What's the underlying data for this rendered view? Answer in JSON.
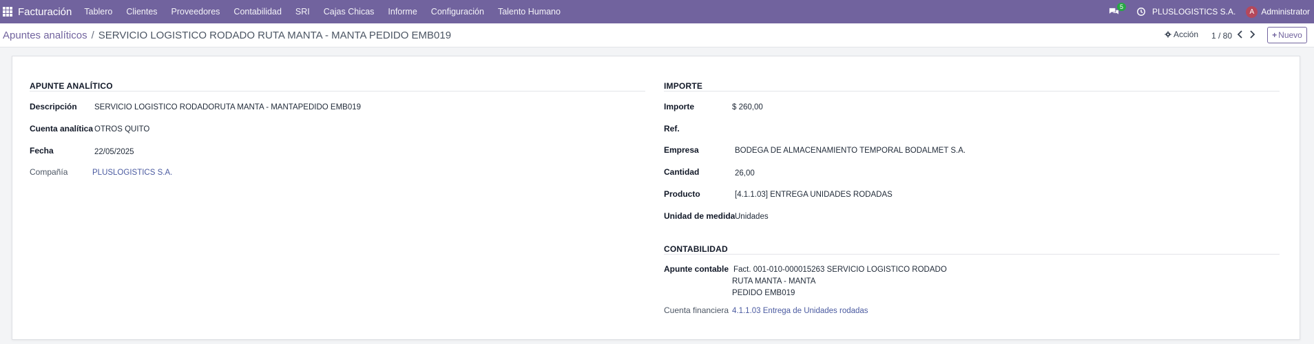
{
  "navbar": {
    "app_name": "Facturación",
    "menu": [
      "Tablero",
      "Clientes",
      "Proveedores",
      "Contabilidad",
      "SRI",
      "Cajas Chicas",
      "Informe",
      "Configuración",
      "Talento Humano"
    ],
    "chat_count": "5",
    "company": "PLUSLOGISTICS S.A.",
    "avatar_letter": "A",
    "user": "Administrator"
  },
  "controlbar": {
    "breadcrumb_parent": "Apuntes analíticos",
    "breadcrumb_separator": "/",
    "breadcrumb_current": "SERVICIO LOGISTICO RODADO RUTA MANTA - MANTA PEDIDO EMB019",
    "action_label": "Acción",
    "pager": "1 / 80",
    "new_label": "Nuevo"
  },
  "form": {
    "left": {
      "title": "APUNTE ANALÍTICO",
      "fields": [
        {
          "label": "Descripción",
          "value": "SERVICIO LOGISTICO RODADORUTA MANTA - MANTAPEDIDO EMB019"
        },
        {
          "label": "Cuenta analítica",
          "value": "OTROS QUITO"
        },
        {
          "label": "Fecha",
          "value": "22/05/2025"
        },
        {
          "label": "Compañía",
          "value": "PLUSLOGISTICS S.A."
        }
      ]
    },
    "right": {
      "title": "IMPORTE",
      "fields": [
        {
          "label": "Importe",
          "value": "$ 260,00"
        },
        {
          "label": "Ref.",
          "value": ""
        },
        {
          "label": "Empresa",
          "value": "BODEGA DE ALMACENAMIENTO TEMPORAL BODALMET S.A."
        },
        {
          "label": "Cantidad",
          "value": "26,00"
        },
        {
          "label": "Producto",
          "value": "[4.1.1.03] ENTREGA UNIDADES RODADAS"
        },
        {
          "label": "Unidad de medida",
          "value": "Unidades"
        }
      ]
    },
    "accounting": {
      "title": "CONTABILIDAD",
      "entry_label": "Apunte contable",
      "entry_lines": [
        "Fact. 001-010-000015263 SERVICIO LOGISTICO RODADO",
        "RUTA MANTA - MANTA",
        "PEDIDO EMB019"
      ],
      "financial_label": "Cuenta financiera",
      "financial_value": "4.1.1.03 Entrega de Unidades rodadas"
    }
  },
  "colors": {
    "navbar": "#71639e",
    "link": "#4a5aa0",
    "badge": "#28a745",
    "avatar": "#b5485b"
  }
}
